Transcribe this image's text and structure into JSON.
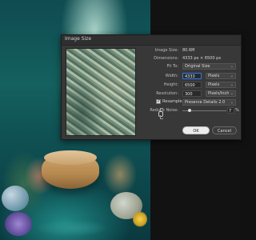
{
  "dialog": {
    "title": "Image Size",
    "image_size_label": "Image Size:",
    "image_size_value": "80.6M",
    "dimensions_label": "Dimensions:",
    "dimensions_value": "4333 px  ×  6500 px",
    "fit_to_label": "Fit To:",
    "fit_to_value": "Original Size",
    "width_label": "Width:",
    "width_value": "4333",
    "width_unit": "Pixels",
    "height_label": "Height:",
    "height_value": "6500",
    "height_unit": "Pixels",
    "resolution_label": "Resolution:",
    "resolution_value": "300",
    "resolution_unit": "Pixels/Inch",
    "resample_label": "Resample:",
    "resample_value": "Preserve Details 2.0",
    "reduce_noise_label": "Reduce Noise:",
    "reduce_noise_value": "7",
    "reduce_noise_unit": "%",
    "ok_label": "OK",
    "cancel_label": "Cancel"
  },
  "icons": {
    "constrain": "link-chain-icon",
    "chevron": "chevron-down-icon",
    "check": "checkmark-icon"
  },
  "colors": {
    "dialog_bg": "#383838",
    "titlebar_bg": "#2f2f2f",
    "active_field_border": "#3b7bd8",
    "ok_button_bg": "#ececec"
  }
}
